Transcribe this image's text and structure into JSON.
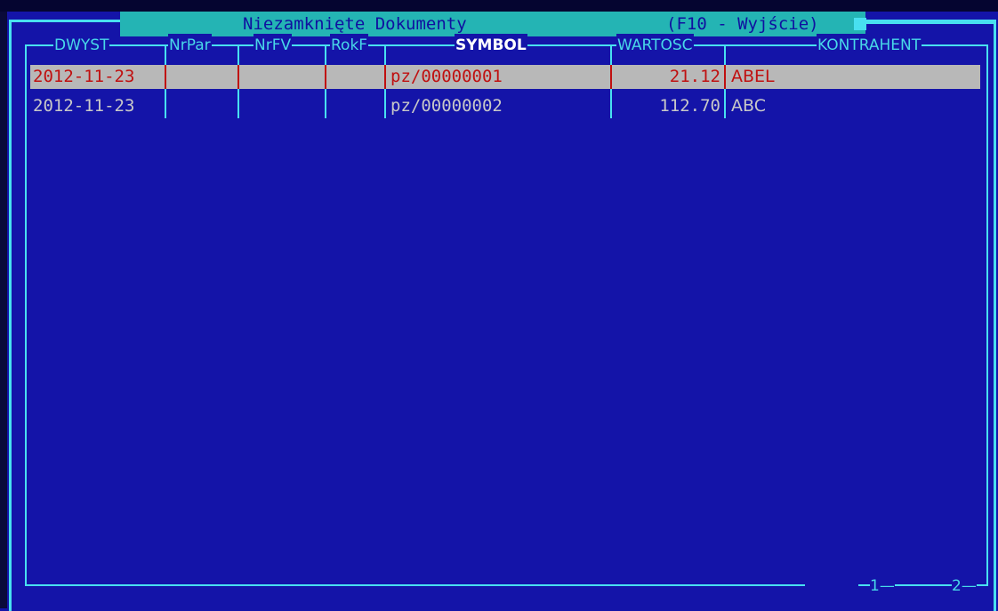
{
  "window": {
    "title": "Niezamknięte Dokumenty",
    "hint": "(F10 - Wyjście)"
  },
  "columns": [
    "DWYST",
    "NrPar",
    "NrFV",
    "RokF",
    "SYMBOL",
    "WARTOSC",
    "KONTRAHENT"
  ],
  "active_column": "SYMBOL",
  "rows": [
    {
      "dwyst": "2012-11-23",
      "nrpar": "",
      "nrfv": "",
      "rokf": "",
      "symbol": "pz/00000001",
      "wartosc": "21.12",
      "kontrahent": "ABEL",
      "selected": true
    },
    {
      "dwyst": "2012-11-23",
      "nrpar": "",
      "nrfv": "",
      "rokf": "",
      "symbol": "pz/00000002",
      "wartosc": "112.70",
      "kontrahent": "ABC",
      "selected": false
    }
  ],
  "footer": {
    "page_marker_1": "1",
    "page_marker_2": "2"
  },
  "colors": {
    "background": "#1414a8",
    "frame": "#48e0f0",
    "title_bar": "#24b4b4",
    "selection_bg": "#b8b8b8",
    "selection_text": "#c01010",
    "row_text": "#c8c8c8"
  }
}
